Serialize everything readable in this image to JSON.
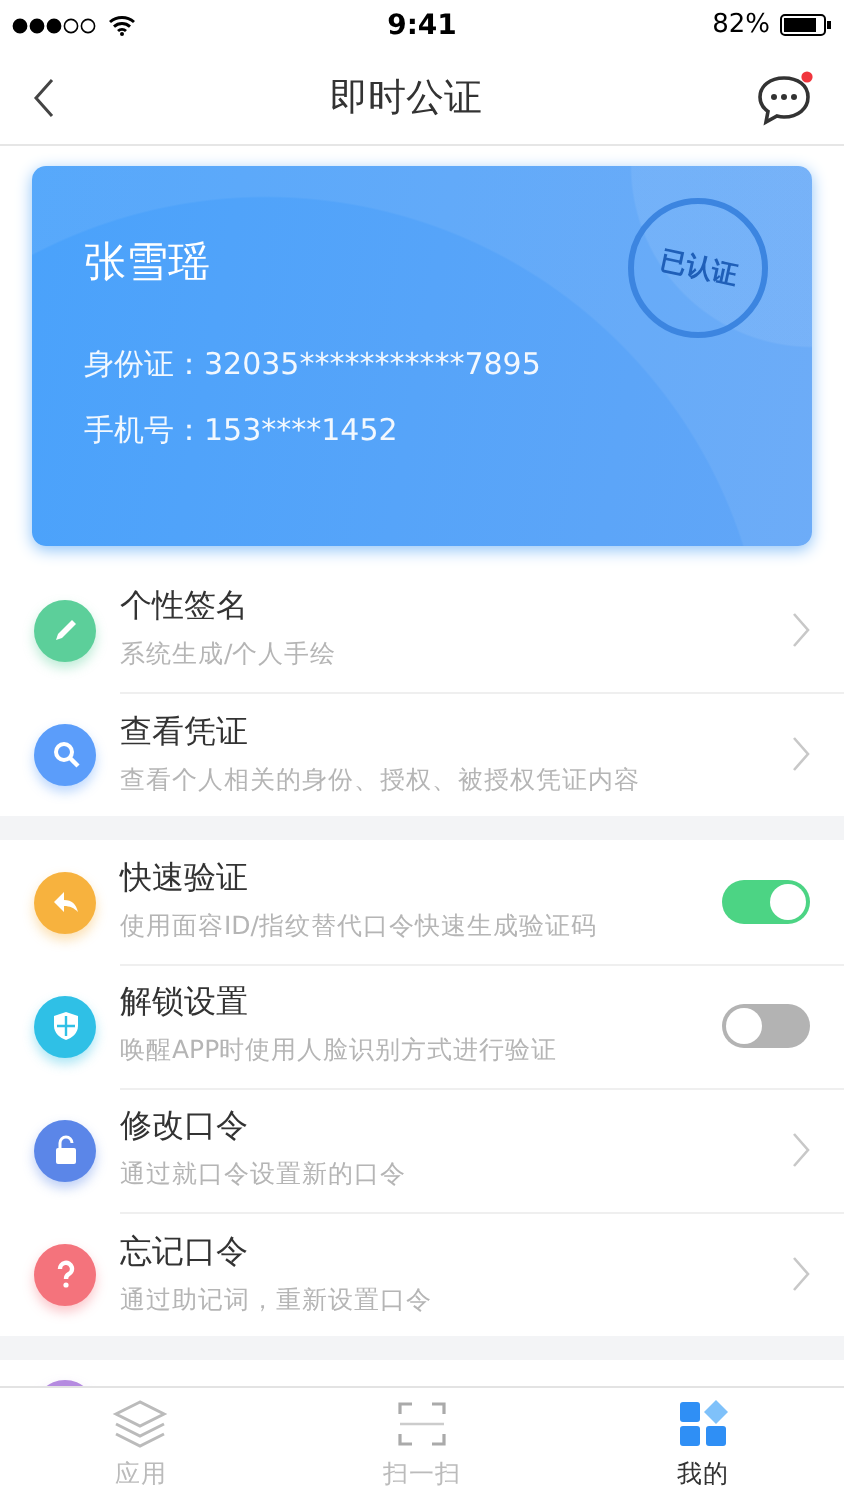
{
  "status_bar": {
    "time": "9:41",
    "battery": "82%"
  },
  "nav": {
    "title": "即时公证",
    "has_notification": true
  },
  "card": {
    "name": "张雪瑶",
    "stamp": "已认证",
    "fields": [
      {
        "label": "身份证：",
        "value": "32035***********7895"
      },
      {
        "label": "手机号：",
        "value": "153****1452"
      }
    ]
  },
  "groups": [
    {
      "items": [
        {
          "kind": "chevron",
          "color": "#5ccf9a",
          "title": "个性签名",
          "subtitle": "系统生成/个人手绘"
        },
        {
          "kind": "chevron",
          "color": "#5b9dfa",
          "title": "查看凭证",
          "subtitle": "查看个人相关的身份、授权、被授权凭证内容"
        }
      ]
    },
    {
      "items": [
        {
          "kind": "toggle",
          "color": "#f7b23e",
          "title": "快速验证",
          "subtitle": "使用面容ID/指纹替代口令快速生成验证码",
          "on": true
        },
        {
          "kind": "toggle",
          "color": "#2fc0e6",
          "title": "解锁设置",
          "subtitle": "唤醒APP时使用人脸识别方式进行验证",
          "on": false
        },
        {
          "kind": "chevron",
          "color": "#5b86e8",
          "title": "修改口令",
          "subtitle": "通过就口令设置新的口令"
        },
        {
          "kind": "chevron",
          "color": "#f4737c",
          "title": "忘记口令",
          "subtitle": "通过助记词，重新设置口令"
        }
      ]
    },
    {
      "items": [
        {
          "kind": "partial",
          "color": "#b58be0"
        }
      ]
    }
  ],
  "tabs": [
    {
      "label": "应用",
      "selected": false
    },
    {
      "label": "扫一扫",
      "selected": false
    },
    {
      "label": "我的",
      "selected": true
    }
  ]
}
